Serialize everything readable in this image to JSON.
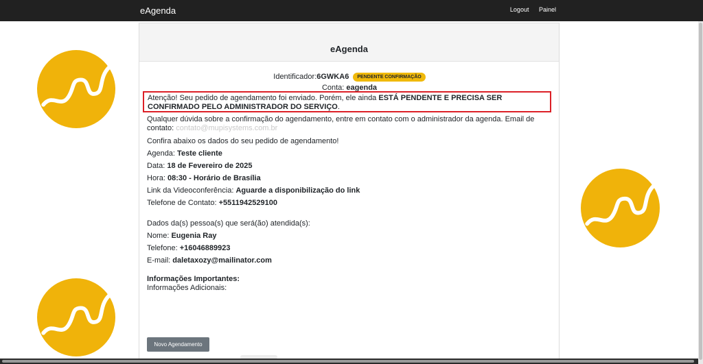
{
  "navbar": {
    "brand": "eAgenda",
    "logout": "Logout",
    "painel": "Painel"
  },
  "card": {
    "title": "eAgenda",
    "identificador_label": "Identificador:",
    "identificador_value": "6GWKA6",
    "status_badge": "PENDENTE CONFIRMAÇÃO",
    "conta_label": "Conta:",
    "conta_value": "eagenda",
    "alert": {
      "text_a": "Atenção! Seu pedido de agendamento foi enviado. Porém, ele ainda ",
      "text_bold": "ESTÁ PENDENTE E PRECISA SER CONFIRMADO PELO ADMINISTRADOR DO SERVIÇO",
      "text_end": "."
    },
    "contact_text": "Qualquer dúvida sobre a confirmação do agendamento, entre em contato com o administrador da agenda. Email de contato:",
    "contact_email": "contato@mupisystems.com.br",
    "confira": "Confira abaixo os dados do seu pedido de agendamento!",
    "agenda_label": "Agenda:",
    "agenda_value": "Teste cliente",
    "data_label": "Data:",
    "data_value": "18 de Fevereiro de 2025",
    "hora_label": "Hora:",
    "hora_value": "08:30 - Horário de Brasília",
    "link_label": "Link da Videoconferência:",
    "link_value": "Aguarde a disponibilização do link",
    "telefone_contato_label": "Telefone de Contato:",
    "telefone_contato_value": "+5511942529100",
    "pessoas_heading": "Dados da(s) pessoa(s) que será(ão) atendida(s):",
    "nome_label": "Nome:",
    "nome_value": "Eugenia Ray",
    "telefone_label": "Telefone:",
    "telefone_value": "+16046889923",
    "email_label": "E-mail:",
    "email_value": "daletaxozy@mailinator.com",
    "info_heading": "Informações Importantes:",
    "info_adicionais": "Informações Adicionais:",
    "novo_button": "Novo Agendamento"
  },
  "colors": {
    "brand_yellow": "#f0b30a",
    "alert_border": "#dc1f26",
    "navbar": "#212121"
  }
}
